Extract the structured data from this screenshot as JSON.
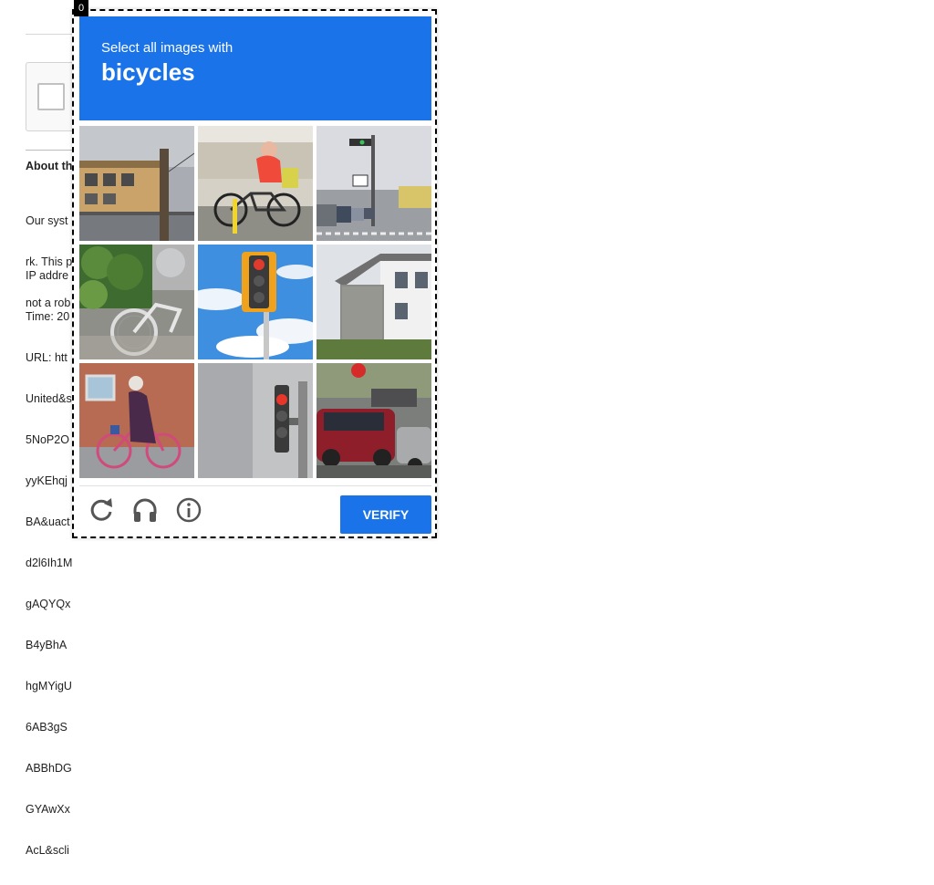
{
  "background": {
    "about_heading": "About th",
    "text_block_1": [
      "Our syst",
      "rk. This p",
      "not a rob"
    ],
    "text_block_2": [
      "IP addre",
      "Time: 20",
      "URL: htt",
      "United&s",
      "5NoP2O",
      "yyKEhqj",
      "BA&uact",
      "d2l6Ih1M",
      "gAQYQx",
      "B4yBhA",
      "hgMYigU",
      "6AB3gS",
      "ABBhDG",
      "GYAwXx",
      "AcL&scli"
    ]
  },
  "challenge": {
    "badge": "0",
    "instruction": "Select all images with",
    "target": "bicycles",
    "tiles": [
      {
        "label": "building-with-pole"
      },
      {
        "label": "cyclist-red-shirt"
      },
      {
        "label": "street-traffic-light-road"
      },
      {
        "label": "parked-bicycle-plants"
      },
      {
        "label": "traffic-light-blue-sky"
      },
      {
        "label": "house-brick-building"
      },
      {
        "label": "woman-cycling-brick-wall"
      },
      {
        "label": "traffic-light-grey-sky"
      },
      {
        "label": "red-cars-street"
      }
    ],
    "buttons": {
      "reload_icon": "reload-icon",
      "audio_icon": "headphones-icon",
      "info_icon": "info-icon",
      "verify_label": "VERIFY"
    },
    "colors": {
      "accent": "#1a73e8"
    }
  }
}
